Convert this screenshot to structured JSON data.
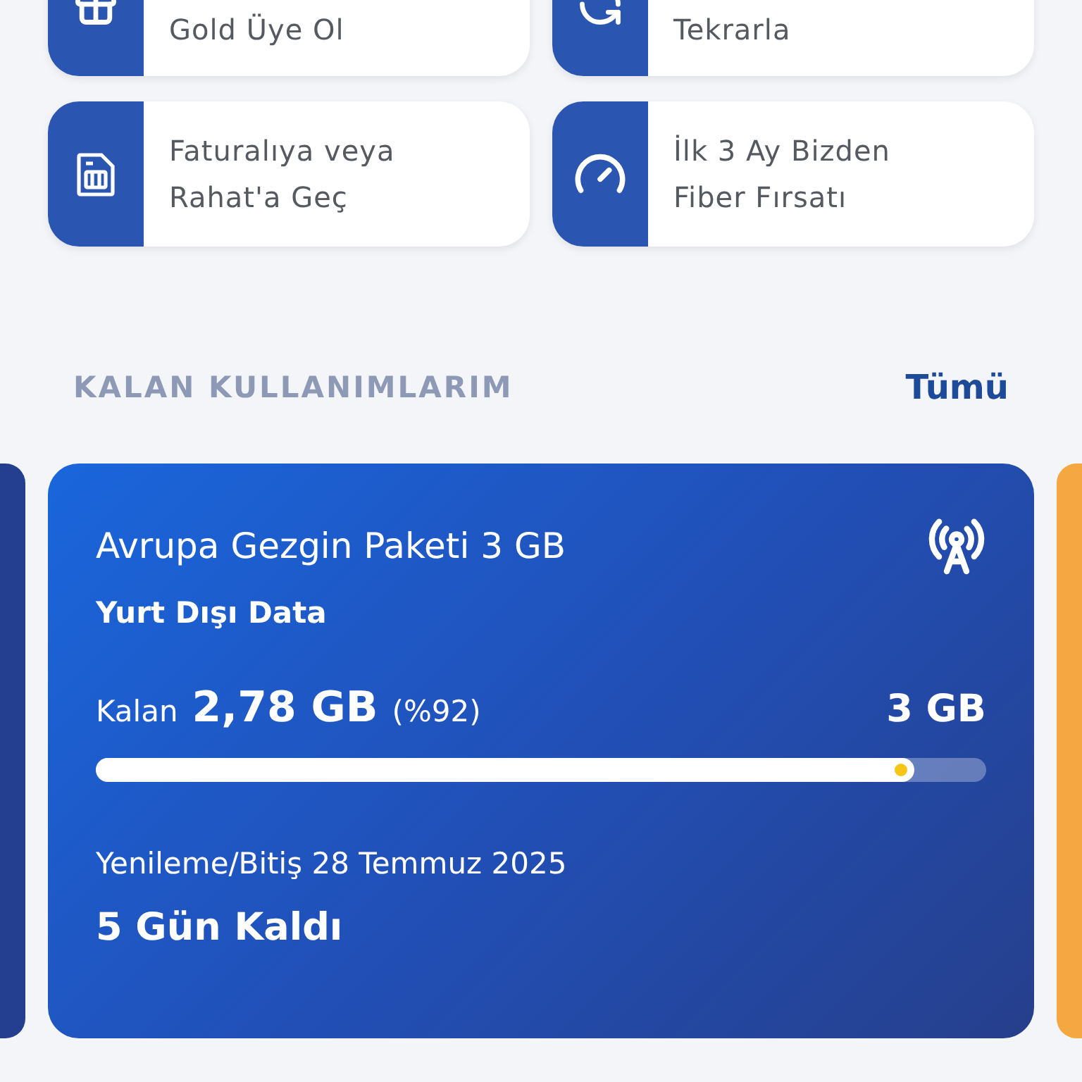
{
  "tiles": [
    {
      "kind": "gift",
      "lines": [
        "Gold Üye Ol"
      ]
    },
    {
      "kind": "refresh",
      "lines": [
        "Tekrarla"
      ]
    },
    {
      "kind": "sim",
      "lines": [
        "Faturalıya veya",
        "Rahat'a Geç"
      ]
    },
    {
      "kind": "gauge",
      "lines": [
        "İlk 3 Ay Bizden",
        "Fiber Fırsatı"
      ]
    }
  ],
  "section": {
    "title": "KALAN KULLANIMLARIM",
    "link": "Tümü"
  },
  "usage_card": {
    "name": "Avrupa Gezgin Paketi 3 GB",
    "type": "Yurt Dışı Data",
    "remaining_label": "Kalan",
    "remaining": "2,78 GB",
    "percent": "(%92)",
    "total": "3 GB",
    "level": 0.92,
    "renewal": "Yenileme/Bitiş 28 Temmuz 2025",
    "days_left": "5 Gün Kaldı"
  }
}
